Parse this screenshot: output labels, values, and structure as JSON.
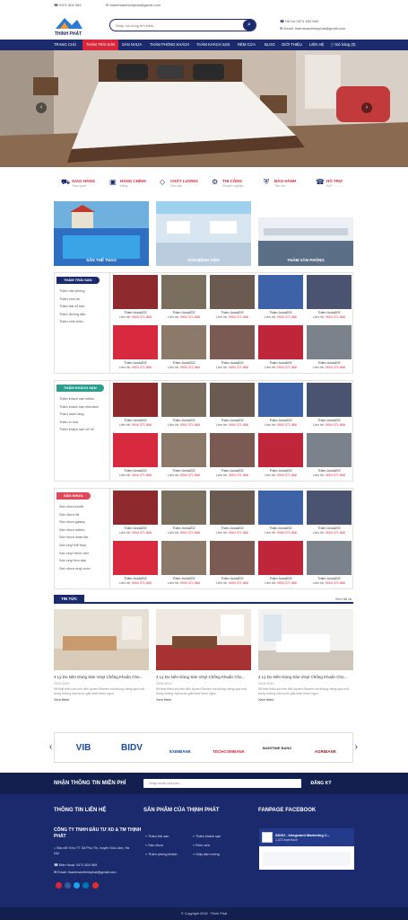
{
  "topbar": {
    "phone": "0971 804 969",
    "email": "thamtrsanthinhphat@gmail.com"
  },
  "header": {
    "logo_text": "THINH PHÁT",
    "search_placeholder": "Nhập nội dung tìm kiếm...",
    "hotline": "Hỗ trợ 0971 804 969",
    "email": "Email: thamtrsanthinhphat@gmail.com"
  },
  "nav": [
    "TRANG CHỦ",
    "THẢM TRẢI SÀN",
    "SÀN NHỰA",
    "THẢM PHÒNG KHÁCH",
    "THẢM KHÁCH SẠN",
    "RÈM CỬA",
    "BLOG",
    "GIỚI THIỆU",
    "LIÊN HỆ",
    "Giỏ hàng (0)"
  ],
  "features": [
    {
      "title": "GIAO HÀNG",
      "sub": "Toàn quốc",
      "icon": "truck-icon"
    },
    {
      "title": "HÀNG CHÍNH",
      "sub": "Hãng",
      "icon": "bag-icon"
    },
    {
      "title": "CHẤT LƯỢNG",
      "sub": "Cao cấp",
      "icon": "diamond-icon"
    },
    {
      "title": "THI CÔNG",
      "sub": "Chuyên nghiệp",
      "icon": "gear-icon"
    },
    {
      "title": "BẢO HÀNH",
      "sub": "Tận nơi",
      "icon": "shield-icon"
    },
    {
      "title": "HỖ TRỢ",
      "sub": "24/7",
      "icon": "phone-icon"
    }
  ],
  "categories": [
    {
      "label": "SÂN THỂ THAO"
    },
    {
      "label": "SÀN BỆNH VIỆN"
    },
    {
      "label": "THẢM VĂN PHÒNG"
    }
  ],
  "sections": [
    {
      "title": "THẢM TRẢI SÀN",
      "head_color": "#1a2a6c",
      "items": [
        "Thảm văn phòng",
        "Thảm chùi ấu",
        "Thảm trải cổ bản",
        "Thảm đường dẫn",
        "Thảm chữ chần"
      ]
    },
    {
      "title": "THẢM KHÁCH SẠN",
      "head_color": "#2a9d8f",
      "items": [
        "Thảm khách sạn milton",
        "Thảm khách sạn sheraton",
        "Thảm hành lang",
        "Thảm in hoa",
        "Thảm khách sạn cỡ xổ"
      ]
    },
    {
      "title": "SÀN NHỰA",
      "head_color": "#e0485a",
      "items": [
        "Sàn nhựa ecofit",
        "Sàn nhựa rất",
        "Sàn nhựa galaxy",
        "Sàn nhựa ruthbo",
        "Sàn nhựa class lite",
        "Sàn vinyl thể thao",
        "Sàn vinyl bệnh viện",
        "Sàn vinyl fem dán",
        "Sàn nhựa vinyl cuộn"
      ]
    }
  ],
  "product": {
    "name": "Thảm Juwal202",
    "price_label": "Liên hệ:",
    "price": "0904 371 868"
  },
  "news": {
    "title": "TIN TỨC",
    "more": "Xem tất cả",
    "items": [
      {
        "title": "4 Lý Do Nên Dùng Sàn Vinyl Chống Khuẩn Cho...",
        "date": "25/01/2019",
        "excerpt": "Sẽ thật thiếu sót nếu đến Ayoen Ramen mà không viếng qua một trong những loại nước giải khát thơm ngon"
      },
      {
        "title": "4 Lý Do Nên Dùng Sàn Vinyl Chống Khuẩn Cho...",
        "date": "25/01/2019",
        "excerpt": "Sẽ thật thiếu sót nếu đến Ayoen Ramen mà không viếng qua một trong những loại nước giải khát thơm ngon"
      },
      {
        "title": "4 Lý Do Nên Dùng Sàn Vinyl Chống Khuẩn Cho...",
        "date": "25/01/2019",
        "excerpt": "Sẽ thật thiếu sót nếu đến Ayoen Ramen mà không viếng qua một trong những loại nước giải khát thơm ngon"
      }
    ],
    "read_more": "Xem thêm"
  },
  "partners": [
    "VIB",
    "BIDV",
    "EXIMBANK",
    "TECHCOMBANK",
    "MARITIME BANK",
    "AGRIBANK"
  ],
  "footer": {
    "newsletter_title": "NHẬN THÔNG TIN MIỄN PHÍ",
    "newsletter_placeholder": "Nhập email của bạn...",
    "subscribe": "ĐĂNG KÝ",
    "contact_title": "THÔNG TIN LIÊN HỆ",
    "company": "CÔNG TY TNHH ĐẦU TƯ XD & TM THỊNH PHÁT",
    "address": "Địa chỉ: Khu TT Xã Phú Thị, huyện Gia Lâm, Hà Nội",
    "phone": "Điện thoại: 0971 804 969",
    "email": "Email: thamtrsanthinhphat@gmail.com",
    "products_title": "SẢN PHẨM CỦA THỊNH PHÁT",
    "products": [
      "Thảm trải sàn",
      "Sàn nhựa",
      "Thảm phòng khách",
      "Thảm khách sạn",
      "Rèm cửa",
      "Giấy dán tường"
    ],
    "fanpage_title": "FANPAGE FACEBOOK",
    "fanpage_name": "SDIGI - Integrated Marketing C...",
    "fanpage_sub": "1,372 lượt thích",
    "copyright": "© Copyright 2018 · Thinh Phát"
  }
}
